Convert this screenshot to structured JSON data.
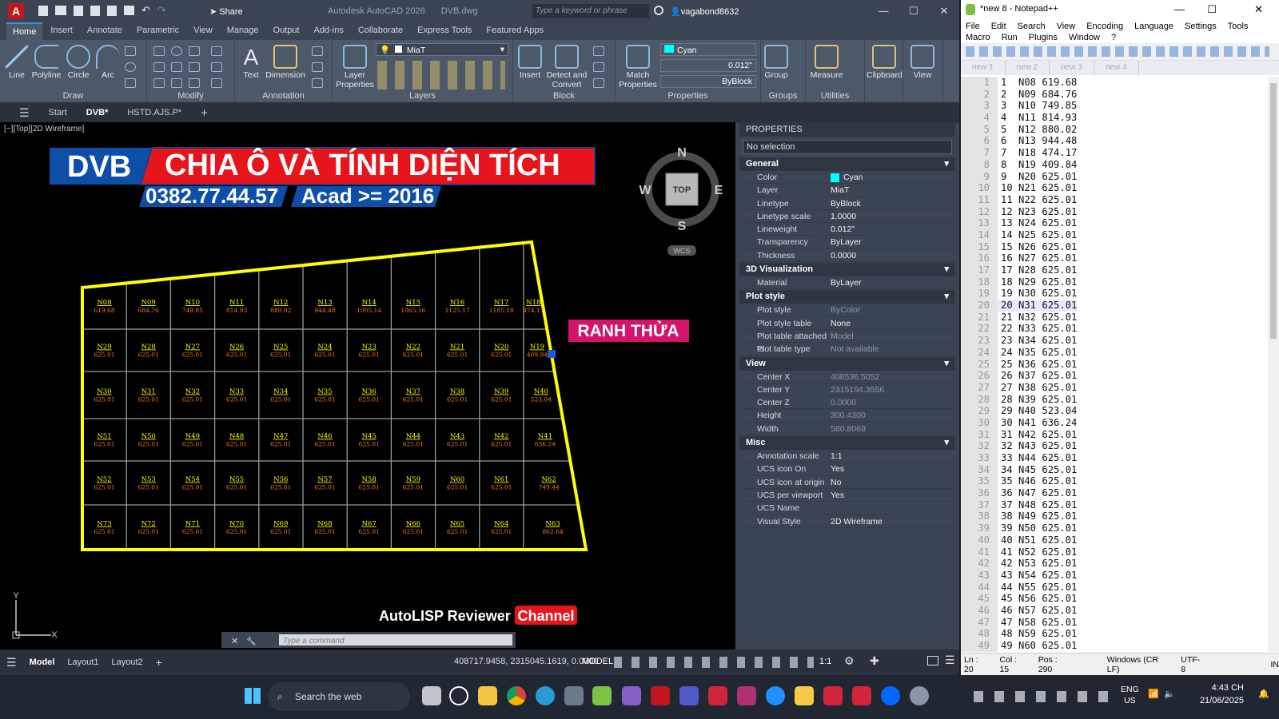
{
  "acad": {
    "title": "Autodesk AutoCAD 2026",
    "file": "DVB.dwg",
    "share": "Share",
    "search_placeholder": "Type a keyword or phrase",
    "user": "vagabond8632",
    "tabs": [
      "Home",
      "Insert",
      "Annotate",
      "Parametric",
      "View",
      "Manage",
      "Output",
      "Add-ins",
      "Collaborate",
      "Express Tools",
      "Featured Apps"
    ],
    "panels": {
      "draw": "Draw",
      "modify": "Modify",
      "annotation": "Annotation",
      "layers": "Layers",
      "block": "Block",
      "properties": "Properties",
      "groups": "Groups",
      "utilities": "Utilities"
    },
    "tools": {
      "line": "Line",
      "polyline": "Polyline",
      "circle": "Circle",
      "arc": "Arc",
      "text": "Text",
      "dimension": "Dimension",
      "layer_props": "Layer\nProperties",
      "insert": "Insert",
      "detect": "Detect and\nConvert",
      "match": "Match\nProperties",
      "group": "Group",
      "measure": "Measure",
      "clipboard": "Clipboard",
      "view": "View"
    },
    "layer_current": "MiaT",
    "color_current": "Cyan",
    "lineweight_current": "0.012\"",
    "linetype_current": "ByBlock",
    "doc_tabs": [
      "Start",
      "DVB*",
      "HSTD.AJS.P*"
    ],
    "viewport_label": "[−][Top][2D Wireframe]",
    "layout_tabs": [
      "Model",
      "Layout1",
      "Layout2"
    ],
    "coords": "408717.9458, 2315045.1619, 0.0000",
    "model": "MODEL",
    "scale": "1:1",
    "command_placeholder": "Type a command"
  },
  "drawing": {
    "banner_left": "DVB",
    "banner_title": "CHIA Ô VÀ TÍNH DIỆN TÍCH",
    "phone": "0382.77.44.57",
    "acad_ver": "Acad >= 2016",
    "boundary_label": "RANH THỬA",
    "footer_brand": "AutoLISP Reviewer",
    "footer_channel": "Channel",
    "compass": {
      "n": "N",
      "s": "S",
      "e": "E",
      "w": "W",
      "top": "TOP",
      "wcs": "WCS"
    },
    "rows": [
      [
        [
          "N08",
          "619.68"
        ],
        [
          "N09",
          "684.76"
        ],
        [
          "N10",
          "749.85"
        ],
        [
          "N11",
          "814.93"
        ],
        [
          "N12",
          "880.02"
        ],
        [
          "N13",
          "944.48"
        ],
        [
          "N14",
          "1005.14"
        ],
        [
          "N15",
          "1065.16"
        ],
        [
          "N16",
          "1125.17"
        ],
        [
          "N17",
          "1185.18"
        ],
        [
          "N18",
          "474.17"
        ]
      ],
      [
        [
          "N29",
          "625.01"
        ],
        [
          "N28",
          "625.01"
        ],
        [
          "N27",
          "625.01"
        ],
        [
          "N26",
          "625.01"
        ],
        [
          "N25",
          "625.01"
        ],
        [
          "N24",
          "625.01"
        ],
        [
          "N23",
          "625.01"
        ],
        [
          "N22",
          "625.01"
        ],
        [
          "N21",
          "625.01"
        ],
        [
          "N20",
          "625.01"
        ],
        [
          "N19",
          "409.84"
        ]
      ],
      [
        [
          "N30",
          "625.01"
        ],
        [
          "N31",
          "625.01"
        ],
        [
          "N32",
          "625.01"
        ],
        [
          "N33",
          "625.01"
        ],
        [
          "N34",
          "625.01"
        ],
        [
          "N35",
          "625.01"
        ],
        [
          "N36",
          "625.01"
        ],
        [
          "N37",
          "625.01"
        ],
        [
          "N38",
          "625.01"
        ],
        [
          "N39",
          "625.01"
        ],
        [
          "N40",
          "523.04"
        ]
      ],
      [
        [
          "N51",
          "625.01"
        ],
        [
          "N50",
          "625.01"
        ],
        [
          "N49",
          "625.01"
        ],
        [
          "N48",
          "625.01"
        ],
        [
          "N47",
          "625.01"
        ],
        [
          "N46",
          "625.01"
        ],
        [
          "N45",
          "625.01"
        ],
        [
          "N44",
          "625.01"
        ],
        [
          "N43",
          "625.01"
        ],
        [
          "N42",
          "625.01"
        ],
        [
          "N41",
          "636.24"
        ]
      ],
      [
        [
          "N52",
          "625.01"
        ],
        [
          "N53",
          "625.01"
        ],
        [
          "N54",
          "625.01"
        ],
        [
          "N55",
          "625.01"
        ],
        [
          "N56",
          "625.01"
        ],
        [
          "N57",
          "625.01"
        ],
        [
          "N58",
          "625.01"
        ],
        [
          "N59",
          "625.01"
        ],
        [
          "N60",
          "625.01"
        ],
        [
          "N61",
          "625.01"
        ],
        [
          "N62",
          "749.44"
        ]
      ],
      [
        [
          "N73",
          "625.01"
        ],
        [
          "N72",
          "625.01"
        ],
        [
          "N71",
          "625.01"
        ],
        [
          "N70",
          "625.01"
        ],
        [
          "N69",
          "625.01"
        ],
        [
          "N68",
          "625.01"
        ],
        [
          "N67",
          "625.01"
        ],
        [
          "N66",
          "625.01"
        ],
        [
          "N65",
          "625.01"
        ],
        [
          "N64",
          "625.01"
        ],
        [
          "N63",
          "862.64"
        ]
      ]
    ]
  },
  "properties": {
    "title": "PROPERTIES",
    "selection": "No selection",
    "sections": [
      {
        "name": "General",
        "rows": [
          [
            "Color",
            "Cyan"
          ],
          [
            "Layer",
            "MiaT"
          ],
          [
            "Linetype",
            "ByBlock"
          ],
          [
            "Linetype scale",
            "1.0000"
          ],
          [
            "Lineweight",
            "0.012\""
          ],
          [
            "Transparency",
            "ByLayer"
          ],
          [
            "Thickness",
            "0.0000"
          ]
        ]
      },
      {
        "name": "3D Visualization",
        "rows": [
          [
            "Material",
            "ByLayer"
          ]
        ]
      },
      {
        "name": "Plot style",
        "rows": [
          [
            "Plot style",
            "ByColor"
          ],
          [
            "Plot style table",
            "None"
          ],
          [
            "Plot table attached to",
            "Model"
          ],
          [
            "Plot table type",
            "Not available"
          ]
        ]
      },
      {
        "name": "View",
        "rows": [
          [
            "Center X",
            "408536.5052"
          ],
          [
            "Center Y",
            "2315194.3556"
          ],
          [
            "Center Z",
            "0.0000"
          ],
          [
            "Height",
            "300.4300"
          ],
          [
            "Width",
            "580.8069"
          ]
        ]
      },
      {
        "name": "Misc",
        "rows": [
          [
            "Annotation scale",
            "1:1"
          ],
          [
            "UCS icon On",
            "Yes"
          ],
          [
            "UCS icon at origin",
            "No"
          ],
          [
            "UCS per viewport",
            "Yes"
          ],
          [
            "UCS Name",
            ""
          ],
          [
            "Visual Style",
            "2D Wireframe"
          ]
        ]
      }
    ]
  },
  "notepad": {
    "title": "*new 8 - Notepad++",
    "menu": [
      "File",
      "Edit",
      "Search",
      "View",
      "Encoding",
      "Language",
      "Settings",
      "Tools",
      "Macro",
      "Run",
      "Plugins",
      "Window",
      "?"
    ],
    "tabs": [
      "new 1",
      "new 2",
      "new 3",
      "new 4"
    ],
    "current_line": 20,
    "lines": [
      "1  N08 619.68",
      "2  N09 684.76",
      "3  N10 749.85",
      "4  N11 814.93",
      "5  N12 880.02",
      "6  N13 944.48",
      "7  N18 474.17",
      "8  N19 409.84",
      "9  N20 625.01",
      "10 N21 625.01",
      "11 N22 625.01",
      "12 N23 625.01",
      "13 N24 625.01",
      "14 N25 625.01",
      "15 N26 625.01",
      "16 N27 625.01",
      "17 N28 625.01",
      "18 N29 625.01",
      "19 N30 625.01",
      "20 N31 625.01",
      "21 N32 625.01",
      "22 N33 625.01",
      "23 N34 625.01",
      "24 N35 625.01",
      "25 N36 625.01",
      "26 N37 625.01",
      "27 N38 625.01",
      "28 N39 625.01",
      "29 N40 523.04",
      "30 N41 636.24",
      "31 N42 625.01",
      "32 N43 625.01",
      "33 N44 625.01",
      "34 N45 625.01",
      "35 N46 625.01",
      "36 N47 625.01",
      "37 N48 625.01",
      "38 N49 625.01",
      "39 N50 625.01",
      "40 N51 625.01",
      "41 N52 625.01",
      "42 N53 625.01",
      "43 N54 625.01",
      "44 N55 625.01",
      "45 N56 625.01",
      "46 N57 625.01",
      "47 N58 625.01",
      "48 N59 625.01",
      "49 N60 625.01"
    ],
    "status": {
      "ln": "Ln : 20",
      "col": "Col : 15",
      "pos": "Pos : 290",
      "eol": "Windows (CR LF)",
      "enc": "UTF-8",
      "ins": "IN"
    }
  },
  "taskbar": {
    "search": "Search the web",
    "lang1": "ENG",
    "lang2": "US",
    "time": "4:43 CH",
    "date": "21/06/2025"
  },
  "colors": {
    "yellow": "#ffff00",
    "red": "#e8141c",
    "blue": "#0d4fa8",
    "cyan": "#00ffff"
  }
}
